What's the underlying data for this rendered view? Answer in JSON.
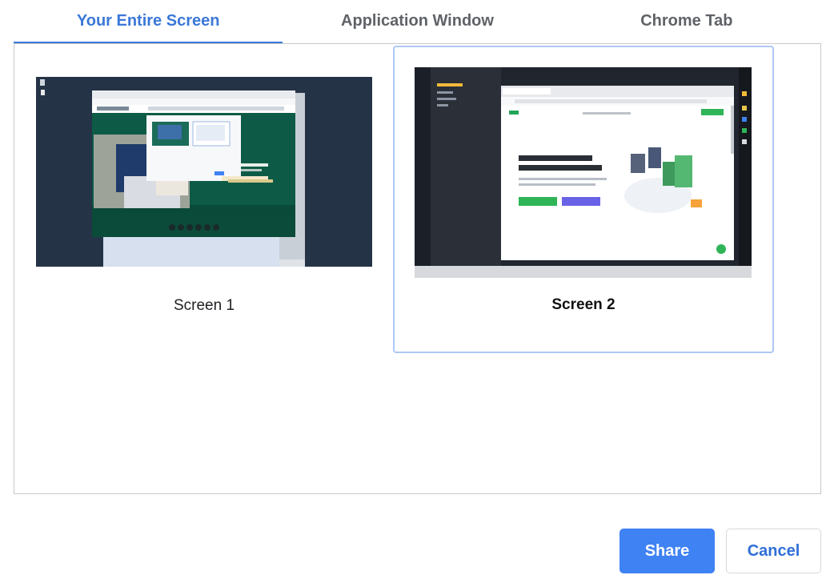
{
  "tabs": [
    {
      "label": "Your Entire Screen",
      "active": true
    },
    {
      "label": "Application Window",
      "active": false
    },
    {
      "label": "Chrome Tab",
      "active": false
    }
  ],
  "sources": [
    {
      "label": "Screen 1",
      "selected": false
    },
    {
      "label": "Screen 2",
      "selected": true
    }
  ],
  "buttons": {
    "share": "Share",
    "cancel": "Cancel"
  },
  "colors": {
    "accent": "#3b78d8",
    "share_button": "#3f82f3",
    "selected_border": "#aec8f5"
  }
}
